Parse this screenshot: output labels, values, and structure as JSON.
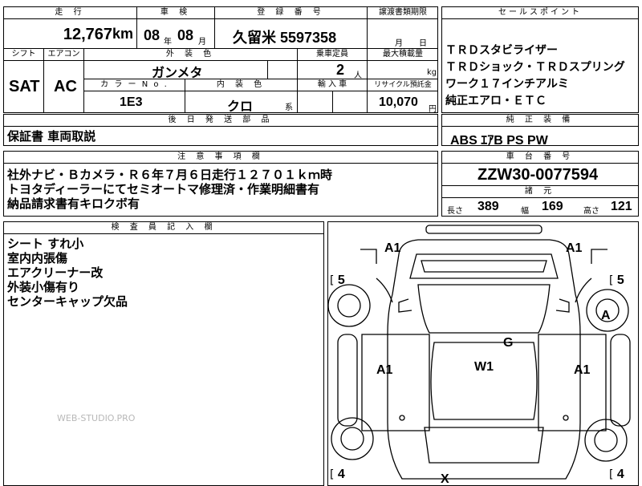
{
  "header": {
    "mileage_label": "走 行",
    "mileage_value": "12,767",
    "mileage_unit": "km",
    "inspection_label": "車 検",
    "inspection_year": "08",
    "inspection_year_unit": "年",
    "inspection_month": "08",
    "inspection_month_unit": "月",
    "registration_label": "登 録 番 号",
    "registration_value": "久留米 5597358",
    "transfer_deadline_label": "譲渡書類期限",
    "transfer_deadline_unit": "月　　日",
    "sales_points_label": "セールスポイント"
  },
  "row2": {
    "shift_label": "シフト",
    "shift_value": "SAT",
    "aircon_label": "エアコン",
    "aircon_value": "AC",
    "exterior_color_label": "外 装 色",
    "exterior_color_value": "ガンメタ",
    "seats_label": "乗車定員",
    "seats_value": "2",
    "seats_unit": "人",
    "max_load_label": "最大積載量",
    "max_load_unit": "kg",
    "color_no_label": "カ ラ ー N o .",
    "color_no_value": "1E3",
    "interior_color_label": "内 装 色",
    "interior_color_value": "クロ",
    "interior_color_suffix": "系",
    "import_label": "輸 入 車",
    "recycle_label": "リサイクル預託金",
    "recycle_value": "10,070",
    "recycle_unit": "円"
  },
  "sales_points": [
    "ＴＲＤスタビライザー",
    "ＴＲＤショック・ＴＲＤスプリング",
    "ワーク１７インチアルミ",
    "純正エアロ・ＥＴＣ"
  ],
  "parts": {
    "label": "後 日 発 送 部 品",
    "value": "保証書 車両取説"
  },
  "equipment": {
    "label": "純 正 装 備",
    "value": "ABS ｴｱB PS PW"
  },
  "notes": {
    "label": "注 意 事 項 欄",
    "lines": [
      "社外ナビ・Ｂカメラ・Ｒ６年７月６日走行１２７０１ｋｍ時",
      "トヨタディーラーにてセミオートマ修理済・作業明細書有",
      "納品請求書有キロクボ有"
    ]
  },
  "chassis": {
    "label": "車 台 番 号",
    "value": "ZZW30-0077594"
  },
  "specs": {
    "label": "諸 元",
    "length_label": "長さ",
    "length_value": "389",
    "width_label": "幅",
    "width_value": "169",
    "height_label": "高さ",
    "height_value": "121"
  },
  "inspector": {
    "label": "検 査 員 記 入 欄",
    "lines": [
      "シート すれ小",
      "室内内張傷",
      "エアクリーナー改",
      "外装小傷有り",
      "センターキャップ欠品"
    ]
  },
  "watermark": "WEB-STUDIO.PRO",
  "diagram": {
    "marks": {
      "front_left": "A1",
      "front_right": "A1",
      "tire_front_left": "5",
      "tire_front_right": "5",
      "tire_front_right_mark": "A",
      "windshield": "G",
      "roof": "W1",
      "left_side": "A1",
      "right_side": "A1",
      "tire_rear_left": "4",
      "tire_rear_right": "4",
      "rear": "X"
    }
  }
}
